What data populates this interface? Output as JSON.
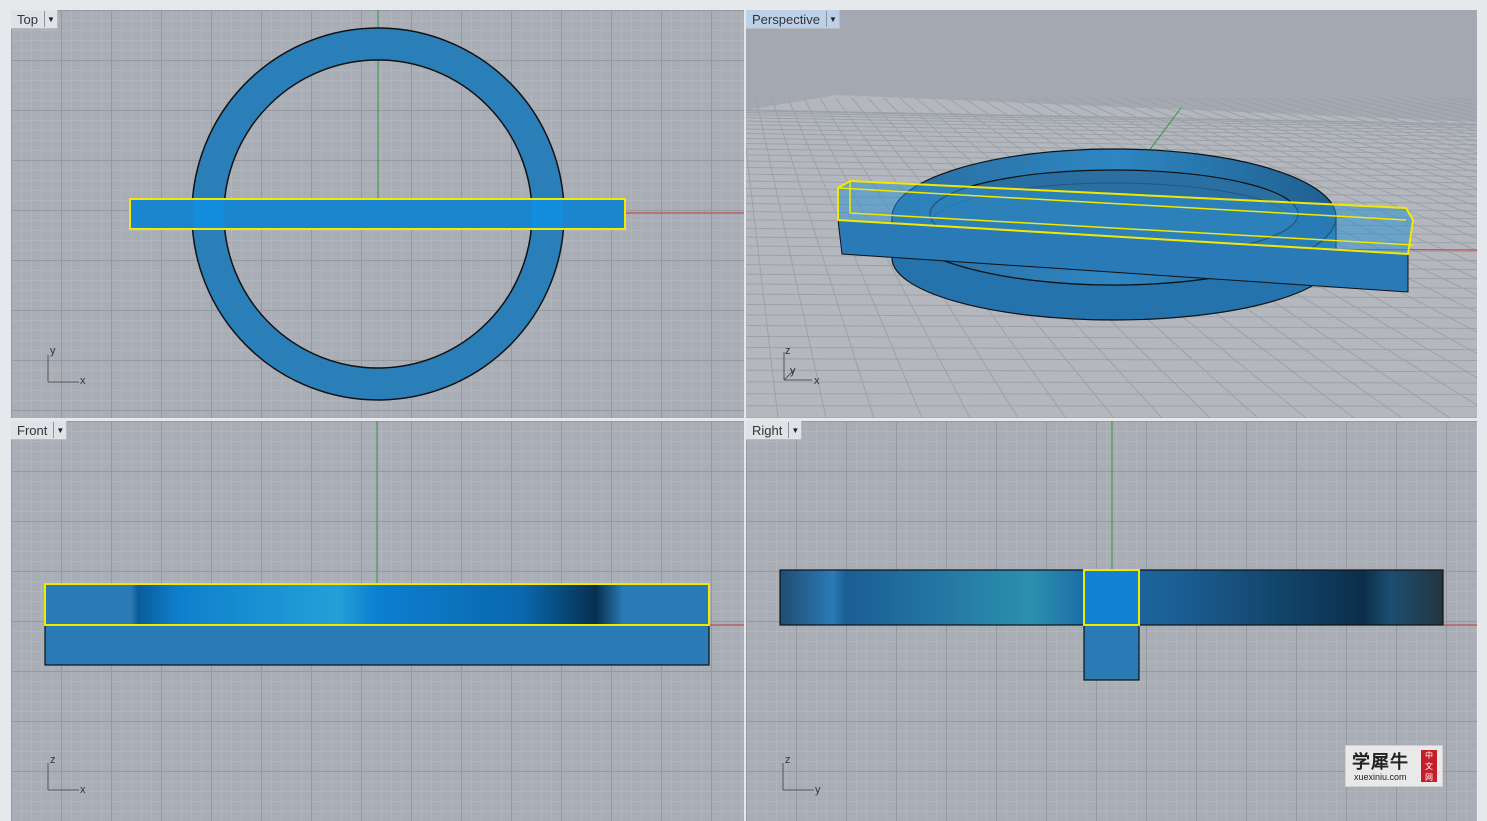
{
  "viewports": {
    "top": {
      "label": "Top",
      "axis_x": "x",
      "axis_y": "y"
    },
    "perspective": {
      "label": "Perspective",
      "axis_x": "x",
      "axis_y": "y",
      "axis_z": "z"
    },
    "front": {
      "label": "Front",
      "axis_x": "x",
      "axis_y": "z"
    },
    "right": {
      "label": "Right",
      "axis_x": "y",
      "axis_y": "z"
    }
  },
  "watermark": {
    "brand": "学犀牛",
    "site": "xuexiniu.com",
    "tag": [
      "中",
      "文",
      "网"
    ]
  },
  "colors": {
    "object": "#2b7fb8",
    "selection": "#ffec00",
    "x_axis": "#c03a34",
    "y_axis": "#2e9a3a",
    "grid_bg": "#a9aeb6"
  },
  "icons": {
    "viewport_menu": "chevron-down-icon"
  }
}
